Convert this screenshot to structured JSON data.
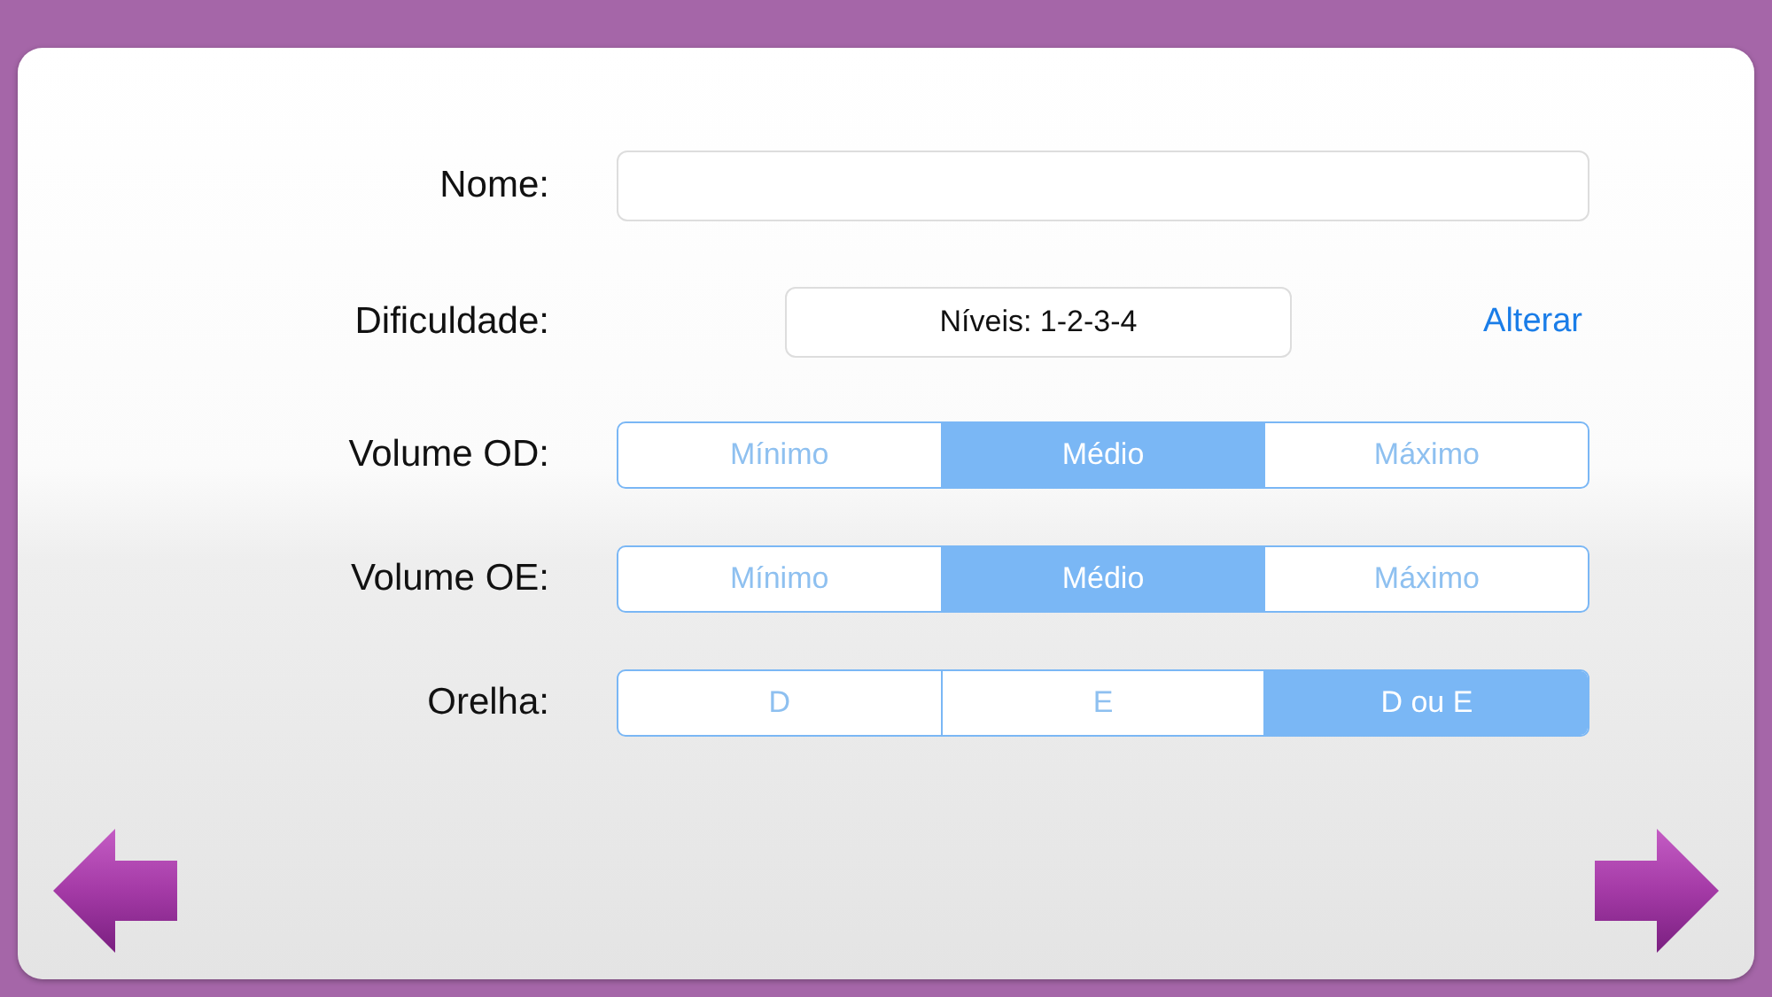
{
  "form": {
    "rows": [
      {
        "kind": "text-field",
        "label": "Nome:",
        "value": ""
      },
      {
        "kind": "picker",
        "label": "Dificuldade:",
        "value": "Níveis: 1-2-3-4",
        "action": "Alterar"
      },
      {
        "kind": "segmented",
        "label": "Volume OD:",
        "options": [
          {
            "label": "Mínimo",
            "selected": false
          },
          {
            "label": "Médio",
            "selected": true
          },
          {
            "label": "Máximo",
            "selected": false
          }
        ]
      },
      {
        "kind": "segmented",
        "label": "Volume OE:",
        "options": [
          {
            "label": "Mínimo",
            "selected": false
          },
          {
            "label": "Médio",
            "selected": true
          },
          {
            "label": "Máximo",
            "selected": false
          }
        ]
      },
      {
        "kind": "segmented",
        "label": "Orelha:",
        "options": [
          {
            "label": "D",
            "selected": false
          },
          {
            "label": "E",
            "selected": false
          },
          {
            "label": "D ou E",
            "selected": true
          }
        ]
      }
    ]
  },
  "navigation": {
    "back": true,
    "forward": true
  }
}
